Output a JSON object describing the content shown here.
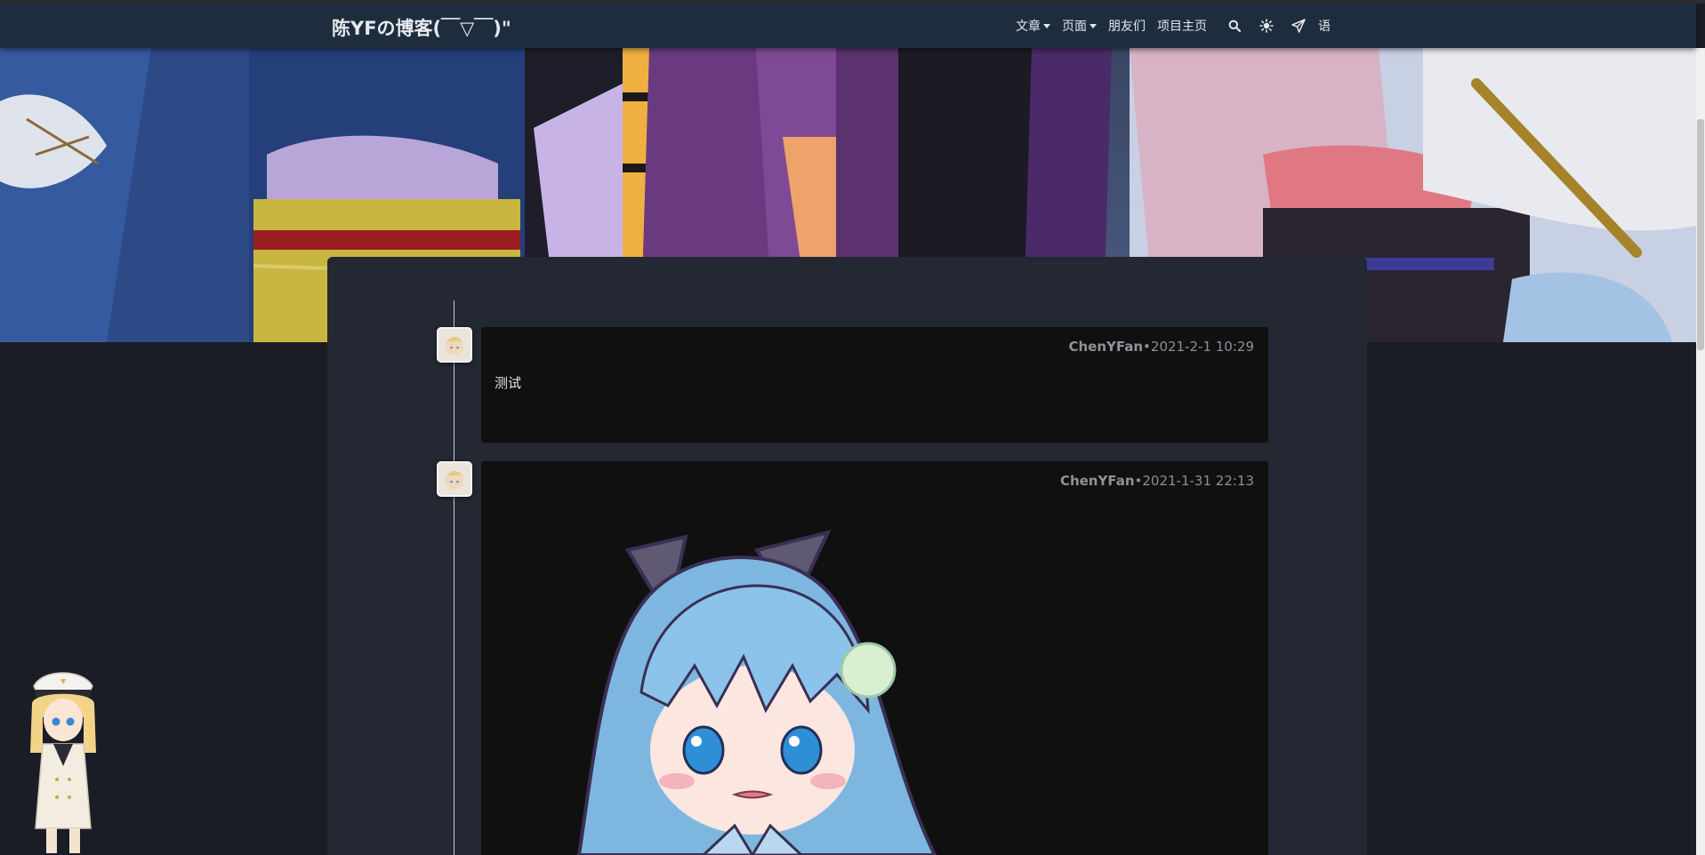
{
  "site": {
    "title": "陈YFの博客(￣▽￣)\""
  },
  "nav": {
    "items": [
      {
        "label": "文章",
        "dropdown": true
      },
      {
        "label": "页面",
        "dropdown": true
      },
      {
        "label": "朋友们",
        "dropdown": false
      },
      {
        "label": "项目主页",
        "dropdown": false
      }
    ],
    "icons": [
      "search-icon",
      "brightness-icon",
      "send-icon"
    ],
    "lang_label": "语"
  },
  "posts": [
    {
      "author": "ChenYFan",
      "separator": "•",
      "time": "2021-2-1 10:29",
      "text": "测试"
    },
    {
      "author": "ChenYFan",
      "separator": "•",
      "time": "2021-1-31 22:13",
      "image": "anime-cat-girl-sticker"
    }
  ],
  "colors": {
    "navbar": "#1e2d3e",
    "page_bg": "#1a1d26",
    "card_bg": "#232833",
    "post_bg": "#101010"
  }
}
